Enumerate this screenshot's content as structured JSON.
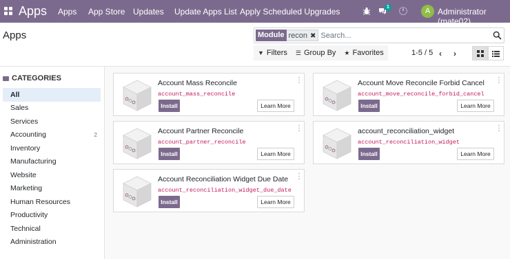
{
  "topbar": {
    "brand": "Apps",
    "menu": [
      "Apps",
      "App Store",
      "Updates",
      "Update Apps List",
      "Apply Scheduled Upgrades"
    ],
    "messages_badge": "1",
    "avatar_letter": "A",
    "username": "Administrator (mate02)",
    "bg_color": "#7c6a8e"
  },
  "control_panel": {
    "title": "Apps",
    "search": {
      "facet_label": "Module",
      "facet_value": "recon",
      "placeholder": "Search..."
    },
    "filters_label": "Filters",
    "groupby_label": "Group By",
    "favorites_label": "Favorites",
    "pager": "1-5 / 5",
    "prev_icon": "‹",
    "next_icon": "›"
  },
  "sidebar": {
    "heading": "CATEGORIES",
    "items": [
      {
        "label": "All",
        "count": "",
        "active": true
      },
      {
        "label": "Sales",
        "count": ""
      },
      {
        "label": "Services",
        "count": ""
      },
      {
        "label": "Accounting",
        "count": "2"
      },
      {
        "label": "Inventory",
        "count": ""
      },
      {
        "label": "Manufacturing",
        "count": ""
      },
      {
        "label": "Website",
        "count": ""
      },
      {
        "label": "Marketing",
        "count": ""
      },
      {
        "label": "Human Resources",
        "count": ""
      },
      {
        "label": "Productivity",
        "count": ""
      },
      {
        "label": "Technical",
        "count": ""
      },
      {
        "label": "Administration",
        "count": ""
      }
    ]
  },
  "apps": [
    {
      "title": "Account Mass Reconcile",
      "tech": "account_mass_reconcile",
      "install": "Install",
      "learn": "Learn More"
    },
    {
      "title": "Account Move Reconcile Forbid Cancel",
      "tech": "account_move_reconcile_forbid_cancel",
      "install": "Install",
      "learn": "Learn More"
    },
    {
      "title": "Account Partner Reconcile",
      "tech": "account_partner_reconcile",
      "install": "Install",
      "learn": "Learn More"
    },
    {
      "title": "account_reconciliation_widget",
      "tech": "account_reconciliation_widget",
      "install": "Install",
      "learn": "Learn More"
    },
    {
      "title": "Account Reconciliation Widget Due Date",
      "tech": "account_reconciliation_widget_due_date",
      "install": "Install",
      "learn": "Learn More"
    }
  ]
}
